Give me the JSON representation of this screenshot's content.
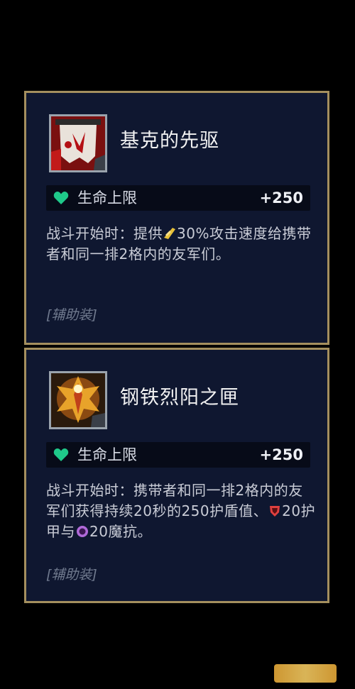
{
  "cards": [
    {
      "name": "基克的先驱",
      "icon": "banner-emblem-icon",
      "stat": {
        "icon": "heart-icon",
        "label": "生命上限",
        "value": "+250"
      },
      "desc_parts": [
        "战斗开始时：提供",
        "30%攻击速度给携带者和同一排2格内的友军们。"
      ],
      "desc_icons": [
        "attack-speed-icon"
      ],
      "tag": "[辅助装]"
    },
    {
      "name": "钢铁烈阳之匣",
      "icon": "sun-emblem-icon",
      "stat": {
        "icon": "heart-icon",
        "label": "生命上限",
        "value": "+250"
      },
      "desc_parts": [
        "战斗开始时：携带者和同一排2格内的友军们获得持续20秒的250护盾值、",
        "20护甲与",
        "20魔抗。"
      ],
      "desc_icons": [
        "armor-icon",
        "magic-resist-icon"
      ],
      "tag": "[辅助装]"
    }
  ],
  "colors": {
    "card_bg": "#0f1730",
    "card_border": "#a48f5e",
    "heart": "#1fc98a",
    "text": "#c9ccd6"
  }
}
